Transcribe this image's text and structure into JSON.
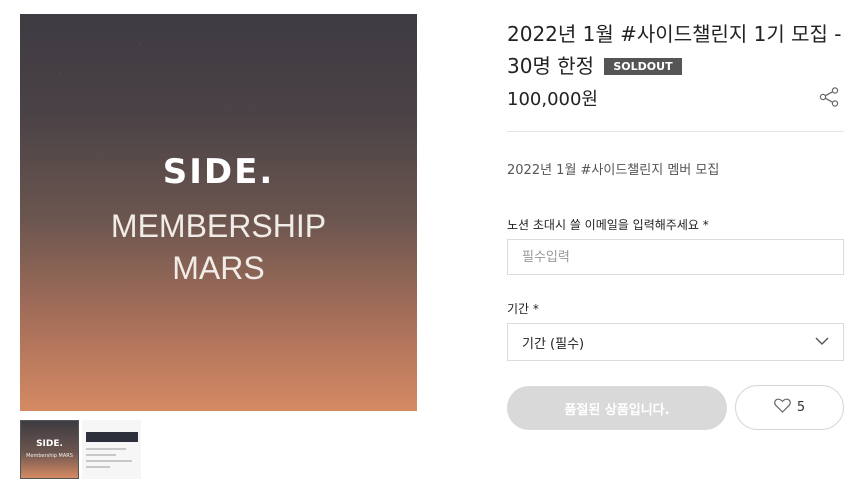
{
  "image": {
    "brand": "SIDE.",
    "line1": "MEMBERSHIP",
    "line2": "MARS",
    "thumb_brand": "SIDE.",
    "thumb_text": "Membership MARS"
  },
  "product": {
    "title": "2022년 1월 #사이드챌린지 1기 모집 - 30명 한정",
    "badge": "SOLDOUT",
    "price": "100,000원",
    "description": "2022년 1월 #사이드챌린지 멤버 모집"
  },
  "form": {
    "email_label": "노션 초대시 쓸 이메일을 입력해주세요 *",
    "email_placeholder": "필수입력",
    "period_label": "기간 *",
    "period_selected": "기간 (필수)"
  },
  "actions": {
    "soldout_label": "품절된 상품입니다.",
    "like_count": "5"
  },
  "icons": {
    "share": "share-icon",
    "chevron": "chevron-down-icon",
    "heart": "heart-icon"
  }
}
